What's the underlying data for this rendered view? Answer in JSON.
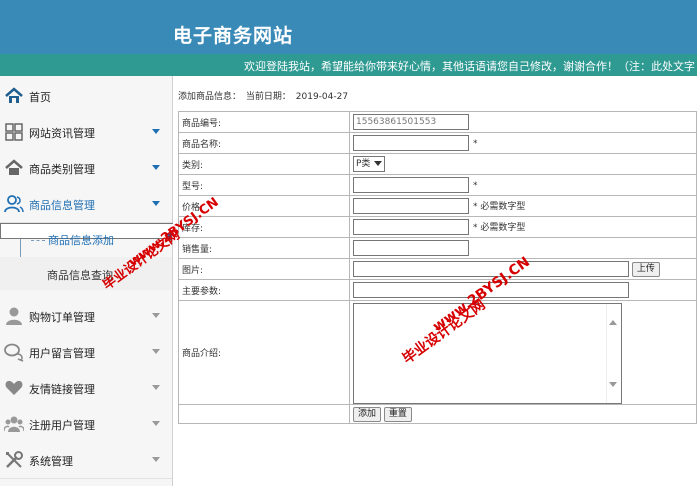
{
  "header": {
    "site_title": "电子商务网站"
  },
  "marquee": {
    "text": "欢迎登陆我站，希望能给你带来好心情，其他话语请您自己修改，谢谢合作！（注：此处文字"
  },
  "sidebar": {
    "items": [
      {
        "label": "首页",
        "icon": "home-icon"
      },
      {
        "label": "网站资讯管理",
        "icon": "grid-icon"
      },
      {
        "label": "商品类别管理",
        "icon": "house-icon"
      },
      {
        "label": "商品信息管理",
        "icon": "users-icon"
      },
      {
        "label": "购物订单管理",
        "icon": "user-icon"
      },
      {
        "label": "用户留言管理",
        "icon": "chat-icon"
      },
      {
        "label": "友情链接管理",
        "icon": "heart-icon"
      },
      {
        "label": "注册用户管理",
        "icon": "group-icon"
      },
      {
        "label": "系统管理",
        "icon": "tools-icon"
      }
    ],
    "sub_items": [
      {
        "label": "商品信息添加"
      },
      {
        "label": "商品信息查询"
      }
    ]
  },
  "page": {
    "info_prefix": "添加商品信息：",
    "date_label": "当前日期：",
    "date_value": "2019-04-27"
  },
  "form": {
    "code_label": "商品编号:",
    "code_value": "15563861501553",
    "name_label": "商品名称:",
    "category_label": "类别:",
    "category_value": "P类",
    "model_label": "型号:",
    "price_label": "价格:",
    "stock_label": "库存:",
    "sales_label": "销售量:",
    "image_label": "图片:",
    "params_label": "主要参数:",
    "intro_label": "商品介绍:",
    "required_mark": "*",
    "numeric_note": "* 必需数字型",
    "upload_label": "上传",
    "submit_label": "添加",
    "reset_label": "重置"
  },
  "watermark": {
    "url": "www.2BYSJ.CN",
    "name": "毕业设计论文网"
  },
  "colors": {
    "header_bg": "#3a8ab7",
    "marquee_bg": "#2f9a92",
    "accent": "#1f6fb3",
    "watermark": "#d60000"
  }
}
